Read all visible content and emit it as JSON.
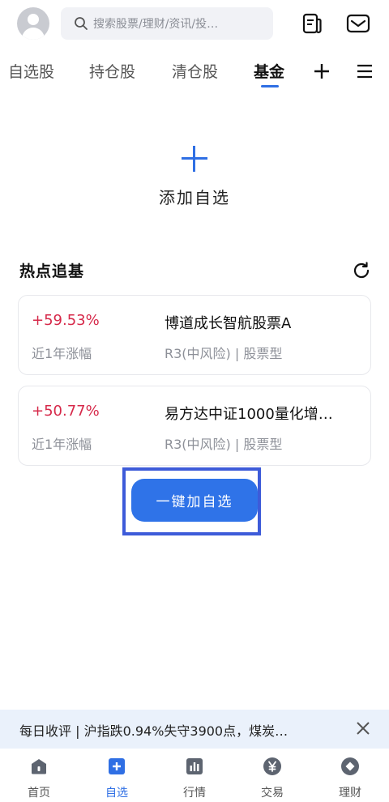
{
  "header": {
    "search_placeholder": "搜索股票/理财/资讯/投…"
  },
  "tabs": [
    {
      "label": "自选股"
    },
    {
      "label": "持仓股"
    },
    {
      "label": "清仓股"
    },
    {
      "label": "基金",
      "active": true
    }
  ],
  "add_watchlist": {
    "label": "添加自选"
  },
  "hot_funds": {
    "title": "热点追基",
    "items": [
      {
        "change": "+59.53%",
        "change_label": "近1年涨幅",
        "name": "博道成长智航股票A",
        "meta": "R3(中风险) | 股票型"
      },
      {
        "change": "+50.77%",
        "change_label": "近1年涨幅",
        "name": "易方达中证1000量化增…",
        "meta": "R3(中风险) | 股票型"
      }
    ],
    "one_click_label": "一键加自选"
  },
  "ticker": {
    "text": "每日收评 | 沪指跌0.94%失守3900点，煤炭…"
  },
  "bottom_nav": [
    {
      "label": "首页",
      "icon": "home-icon"
    },
    {
      "label": "自选",
      "icon": "plus-square-icon",
      "active": true
    },
    {
      "label": "行情",
      "icon": "bar-chart-icon"
    },
    {
      "label": "交易",
      "icon": "yen-icon"
    },
    {
      "label": "理财",
      "icon": "diamond-icon"
    }
  ],
  "colors": {
    "accent": "#2f6fe4",
    "rise": "#d6294a",
    "ticker_bg": "#eaf1fb"
  }
}
